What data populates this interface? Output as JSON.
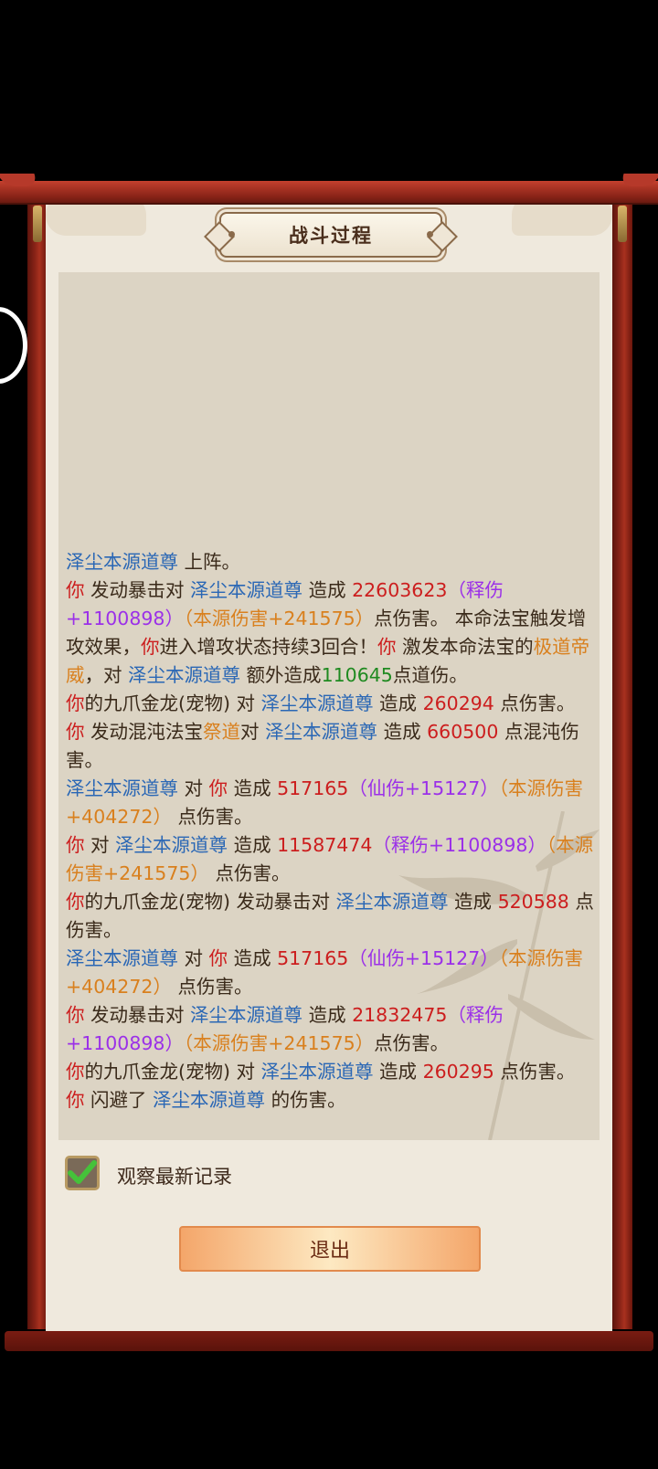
{
  "dialog": {
    "title": "战斗过程",
    "checkbox_label": "观察最新记录",
    "checkbox_checked": true,
    "exit_label": "退出"
  },
  "colors": {
    "enemy_name": "#2a67b5",
    "player": "#cc1e1e",
    "origin_damage": "#d9801e",
    "release_damage": "#9b30e8",
    "dao_damage": "#1f8a20",
    "text": "#3a2a1a"
  },
  "log": [
    [
      {
        "c": "b",
        "t": "泽尘本源道尊"
      },
      {
        "c": "t",
        "t": " 上阵。"
      }
    ],
    [
      {
        "c": "r",
        "t": "你"
      },
      {
        "c": "t",
        "t": " 发动暴击对 "
      },
      {
        "c": "b",
        "t": "泽尘本源道尊"
      },
      {
        "c": "t",
        "t": " 造成 "
      },
      {
        "c": "r",
        "t": "22603623"
      },
      {
        "c": "p",
        "t": "（释伤+1100898）"
      },
      {
        "c": "o",
        "t": "（本源伤害+241575）"
      },
      {
        "c": "t",
        "t": "点伤害。 本命法宝触发增攻效果，"
      },
      {
        "c": "r",
        "t": "你"
      },
      {
        "c": "t",
        "t": "进入增攻状态持续3回合！"
      },
      {
        "c": "r",
        "t": "你"
      },
      {
        "c": "t",
        "t": " 激发本命法宝的"
      },
      {
        "c": "o",
        "t": "极道帝威"
      },
      {
        "c": "t",
        "t": "，对 "
      },
      {
        "c": "b",
        "t": "泽尘本源道尊"
      },
      {
        "c": "t",
        "t": " 额外造成"
      },
      {
        "c": "g",
        "t": "110645"
      },
      {
        "c": "t",
        "t": "点道伤。"
      }
    ],
    [
      {
        "c": "r",
        "t": "你"
      },
      {
        "c": "t",
        "t": "的九爪金龙(宠物) 对 "
      },
      {
        "c": "b",
        "t": "泽尘本源道尊"
      },
      {
        "c": "t",
        "t": " 造成 "
      },
      {
        "c": "r",
        "t": "260294"
      },
      {
        "c": "t",
        "t": " 点伤害。"
      }
    ],
    [
      {
        "c": "r",
        "t": "你"
      },
      {
        "c": "t",
        "t": " 发动混沌法宝"
      },
      {
        "c": "o",
        "t": "祭道"
      },
      {
        "c": "t",
        "t": "对 "
      },
      {
        "c": "b",
        "t": "泽尘本源道尊"
      },
      {
        "c": "t",
        "t": " 造成 "
      },
      {
        "c": "r",
        "t": "660500"
      },
      {
        "c": "t",
        "t": " 点混沌伤害。"
      }
    ],
    [
      {
        "c": "b",
        "t": "泽尘本源道尊"
      },
      {
        "c": "t",
        "t": " 对 "
      },
      {
        "c": "r",
        "t": "你"
      },
      {
        "c": "t",
        "t": " 造成 "
      },
      {
        "c": "r",
        "t": "517165"
      },
      {
        "c": "p",
        "t": "（仙伤+15127）"
      },
      {
        "c": "o",
        "t": "（本源伤害+404272）"
      },
      {
        "c": "t",
        "t": " 点伤害。"
      }
    ],
    [
      {
        "c": "r",
        "t": "你"
      },
      {
        "c": "t",
        "t": " 对 "
      },
      {
        "c": "b",
        "t": "泽尘本源道尊"
      },
      {
        "c": "t",
        "t": " 造成 "
      },
      {
        "c": "r",
        "t": "11587474"
      },
      {
        "c": "p",
        "t": "（释伤+1100898）"
      },
      {
        "c": "o",
        "t": "（本源伤害+241575）"
      },
      {
        "c": "t",
        "t": " 点伤害。"
      }
    ],
    [
      {
        "c": "r",
        "t": "你"
      },
      {
        "c": "t",
        "t": "的九爪金龙(宠物) 发动暴击对 "
      },
      {
        "c": "b",
        "t": "泽尘本源道尊"
      },
      {
        "c": "t",
        "t": " 造成 "
      },
      {
        "c": "r",
        "t": "520588"
      },
      {
        "c": "t",
        "t": " 点伤害。"
      }
    ],
    [
      {
        "c": "b",
        "t": "泽尘本源道尊"
      },
      {
        "c": "t",
        "t": " 对 "
      },
      {
        "c": "r",
        "t": "你"
      },
      {
        "c": "t",
        "t": " 造成 "
      },
      {
        "c": "r",
        "t": "517165"
      },
      {
        "c": "p",
        "t": "（仙伤+15127）"
      },
      {
        "c": "o",
        "t": "（本源伤害+404272）"
      },
      {
        "c": "t",
        "t": " 点伤害。"
      }
    ],
    [
      {
        "c": "r",
        "t": "你"
      },
      {
        "c": "t",
        "t": " 发动暴击对 "
      },
      {
        "c": "b",
        "t": "泽尘本源道尊"
      },
      {
        "c": "t",
        "t": " 造成 "
      },
      {
        "c": "r",
        "t": "21832475"
      },
      {
        "c": "p",
        "t": "（释伤+1100898）"
      },
      {
        "c": "o",
        "t": "（本源伤害+241575）"
      },
      {
        "c": "t",
        "t": "点伤害。"
      }
    ],
    [
      {
        "c": "r",
        "t": "你"
      },
      {
        "c": "t",
        "t": "的九爪金龙(宠物) 对 "
      },
      {
        "c": "b",
        "t": "泽尘本源道尊"
      },
      {
        "c": "t",
        "t": " 造成 "
      },
      {
        "c": "r",
        "t": "260295"
      },
      {
        "c": "t",
        "t": " 点伤害。"
      }
    ],
    [
      {
        "c": "r",
        "t": "你"
      },
      {
        "c": "t",
        "t": " 闪避了 "
      },
      {
        "c": "b",
        "t": "泽尘本源道尊"
      },
      {
        "c": "t",
        "t": " 的伤害。"
      }
    ]
  ]
}
